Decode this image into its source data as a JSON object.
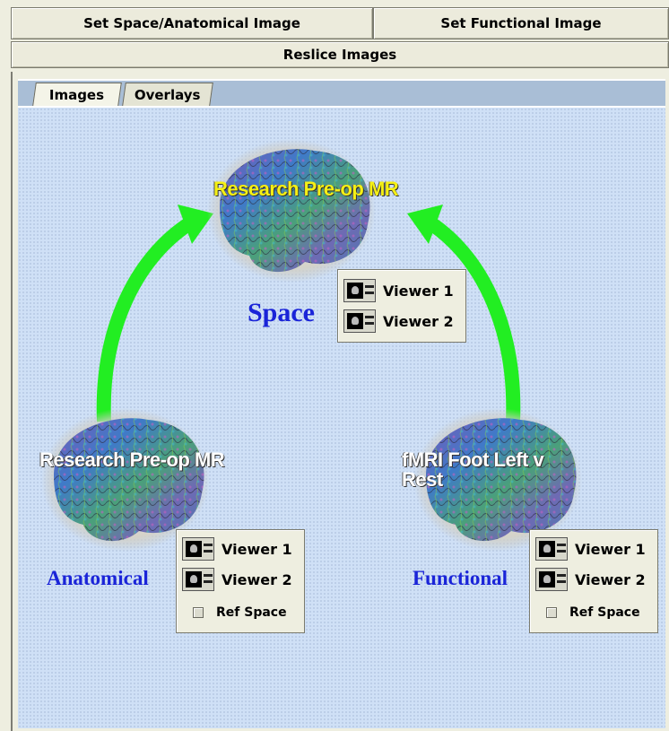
{
  "toolbar": {
    "set_space_label": "Set Space/Anatomical Image",
    "set_functional_label": "Set Functional Image",
    "reslice_label": "Reslice Images"
  },
  "tabs": [
    {
      "label": "Images",
      "selected": true
    },
    {
      "label": "Overlays",
      "selected": false
    }
  ],
  "space": {
    "image_name": "Research Pre-op MR",
    "role": "Space",
    "label_color": "#f5f014",
    "viewers": [
      "Viewer 1",
      "Viewer 2"
    ]
  },
  "anatomical": {
    "image_name": "Research Pre-op MR",
    "role": "Anatomical",
    "label_color": "#ffffff",
    "viewers": [
      "Viewer 1",
      "Viewer 2"
    ],
    "ref_space_label": "Ref Space"
  },
  "functional": {
    "image_name": "fMRI Foot Left v Rest",
    "role": "Functional",
    "label_color": "#ffffff",
    "viewers": [
      "Viewer 1",
      "Viewer 2"
    ],
    "ref_space_label": "Ref Space"
  },
  "colors": {
    "arrow": "#22ee22",
    "role_text": "#1a24d8",
    "tab_strip": "#a9bed6",
    "canvas_bg": "#cfe0f6"
  },
  "icons": {
    "viewer": "viewer-monitor-icon",
    "arrow": "green-curved-arrow",
    "brain": "brain-render-thumbnail"
  }
}
